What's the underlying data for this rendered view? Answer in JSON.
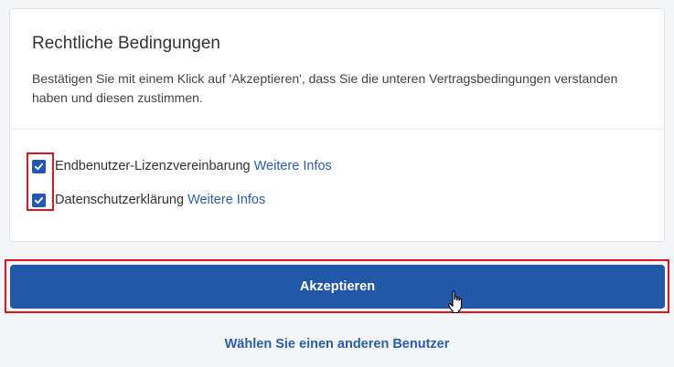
{
  "terms": {
    "title": "Rechtliche Bedingungen",
    "description": "Bestätigen Sie mit einem Klick auf 'Akzeptieren', dass Sie die unteren Vertragsbedingungen verstanden haben und diesen zustimmen.",
    "items": [
      {
        "label": "Endbenutzer-Lizenzvereinbarung",
        "link": "Weitere Infos",
        "checked": true
      },
      {
        "label": "Datenschutzerklärung",
        "link": "Weitere Infos",
        "checked": true
      }
    ]
  },
  "actions": {
    "accept_label": "Akzeptieren",
    "other_user_label": "Wählen Sie einen anderen Benutzer"
  },
  "colors": {
    "accent": "#2357a8",
    "link": "#2a5db0",
    "highlight": "#e0141e"
  },
  "icons": {
    "checkbox": "checkmark-icon",
    "cursor": "hand-pointer-icon"
  }
}
